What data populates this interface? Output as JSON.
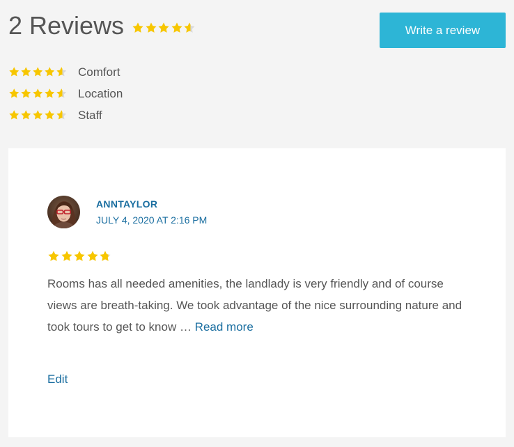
{
  "summary": {
    "count_label": "2 Reviews",
    "overall_rating": 4.6,
    "max_rating": 5,
    "write_review_label": "Write a review"
  },
  "criteria": [
    {
      "label": "Comfort",
      "rating": 4.6
    },
    {
      "label": "Location",
      "rating": 4.6
    },
    {
      "label": "Staff",
      "rating": 4.6
    }
  ],
  "review": {
    "author": "ANNTAYLOR",
    "date": "JULY 4, 2020 AT 2:16 PM",
    "rating": 4.8,
    "text": "Rooms has all needed amenities, the landlady is very friendly and of course views are breath-taking. We took advantage of the nice surrounding nature and took tours to get to know … ",
    "read_more_label": "Read more",
    "edit_label": "Edit"
  },
  "colors": {
    "star_filled": "#f7c600",
    "star_empty": "#d9d9d9",
    "accent_button": "#2db5d6",
    "link": "#1a6ea0",
    "background": "#f4f4f4",
    "card": "#ffffff"
  }
}
